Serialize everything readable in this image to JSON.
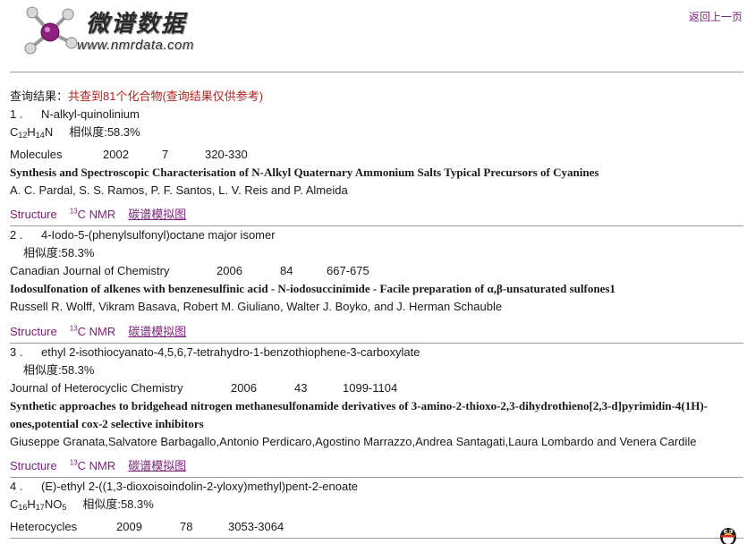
{
  "header": {
    "logo_cn": "微谱数据",
    "logo_url": "www.nmrdata.com",
    "back_link": "返回上一页",
    "accent": "#b0231f",
    "link_color": "#7a1f7a"
  },
  "summary": {
    "label": "查询结果：",
    "text": "共查到81个化合物(查询结果仅供参考)"
  },
  "links": {
    "structure": "Structure",
    "nmr_sup": "13",
    "nmr_label": "C NMR",
    "spectrum": "碳谱模拟图"
  },
  "results": [
    {
      "index": "1 .",
      "name": "N-alkyl-quinolinium",
      "formula": [
        "C",
        "12",
        "H",
        "14",
        "N",
        "",
        "",
        ""
      ],
      "similarity": "相似度:58.3%",
      "journal": "Molecules",
      "year": "2002",
      "volume": "7",
      "pages": "320-330",
      "title": "Synthesis and Spectroscopic Characterisation of N-Alkyl Quaternary Ammonium Salts Typical Precursors of Cyanines",
      "authors": "A. C. Pardal, S. S. Ramos, P. F. Santos, L. V. Reis and P. Almeida"
    },
    {
      "index": "2 .",
      "name": "4-Iodo-5-(phenylsulfonyl)octane major isomer",
      "similarity": "相似度:58.3%",
      "journal": "Canadian Journal of Chemistry",
      "year": "2006",
      "volume": "84",
      "pages": "667-675",
      "title": "Iodosulfonation of alkenes with benzenesulfinic acid - N-iodosuccinimide - Facile preparation of α,β-unsaturated sulfones1",
      "authors": "Russell R. Wolff, Vikram Basava, Robert M. Giuliano, Walter J. Boyko, and J. Herman Schauble"
    },
    {
      "index": "3 .",
      "name": "ethyl 2-isothiocyanato-4,5,6,7-tetrahydro-1-benzothiophene-3-carboxylate",
      "similarity": "相似度:58.3%",
      "journal": "Journal of Heterocyclic Chemistry",
      "year": "2006",
      "volume": "43",
      "pages": "1099-1104",
      "title": "Synthetic approaches to bridgehead nitrogen methanesulfonamide derivatives of 3-amino-2-thioxo-2,3-dihydrothieno[2,3-d]pyrimidin-4(1H)-ones,potential cox-2 selective inhibitors",
      "authors": "Giuseppe Granata,Salvatore Barbagallo,Antonio Perdicaro,Agostino Marrazzo,Andrea Santagati,Laura Lombardo and Venera Cardile"
    },
    {
      "index": "4 .",
      "name": "(E)-ethyl 2-((1,3-dioxoisoindolin-2-yloxy)methyl)pent-2-enoate",
      "formula": [
        "C",
        "16",
        "H",
        "17",
        "N",
        "",
        "O",
        "5"
      ],
      "similarity": "相似度:58.3%",
      "journal": "Heterocycles",
      "year": "2009",
      "volume": "78",
      "pages": "3053-3064"
    }
  ]
}
